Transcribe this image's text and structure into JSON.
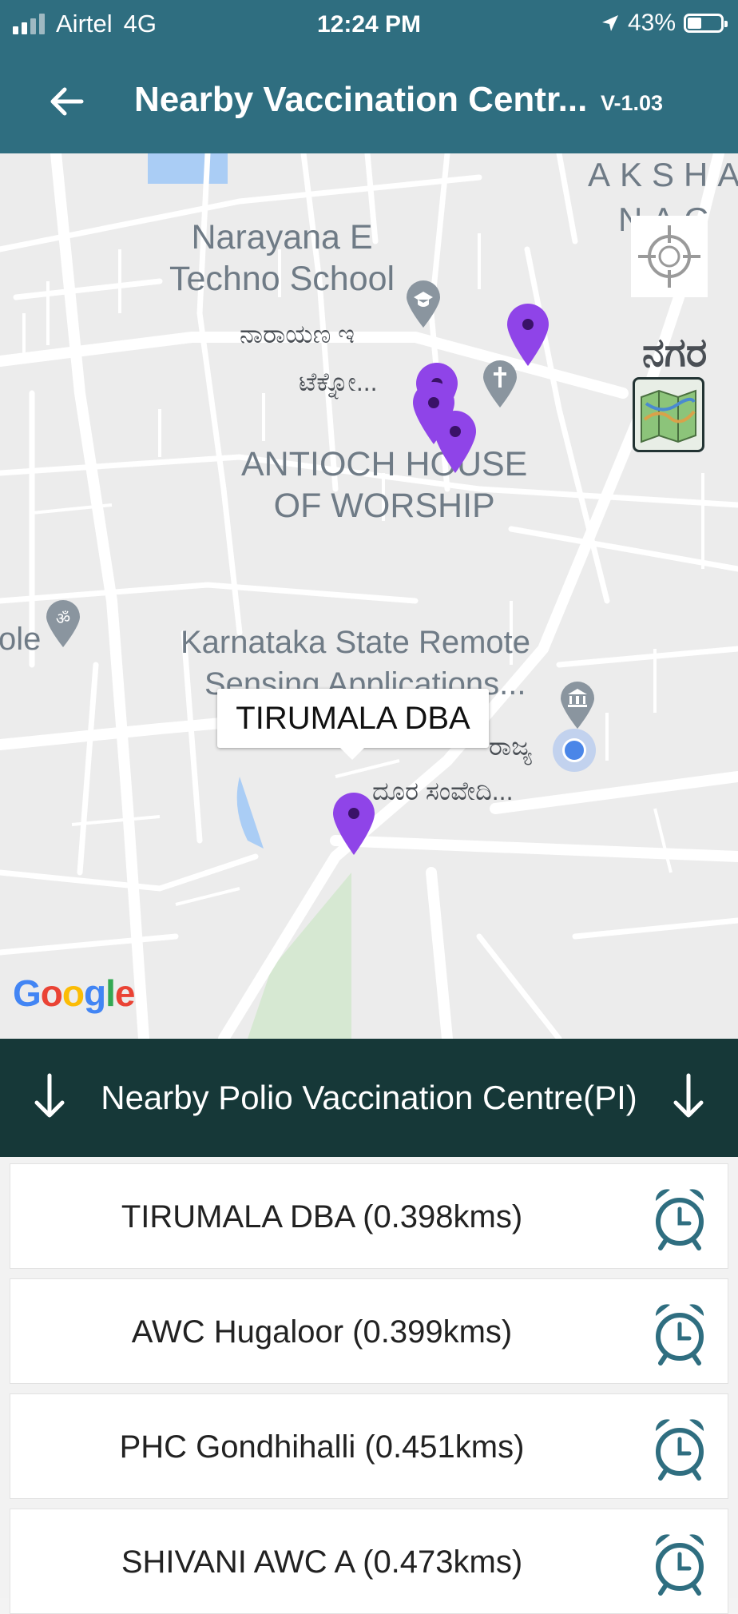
{
  "status_bar": {
    "carrier": "Airtel",
    "network": "4G",
    "time": "12:24 PM",
    "battery": "43%",
    "battery_level": 0.43,
    "signal_bars": 2
  },
  "app_bar": {
    "back_icon": "arrow-left-icon",
    "title": "Nearby Vaccination Centr...",
    "version": "V-1.03"
  },
  "map": {
    "labels": {
      "aksha": "AKSHA",
      "nagar_partial": "NAG",
      "nagara_kannada": "ನಗರ",
      "narayana_school": "Narayana E\nTechno School",
      "narayana_kannada_1": "ನಾರಾಯಣ ಇ",
      "narayana_kannada_2": "ಟೆಕ್ನೋ...",
      "antioch": "ANTIOCH HOUSE\nOF WORSHIP",
      "karnataka_remote_1": "Karnataka State Remote",
      "karnataka_remote_2": "Sensing Applications...",
      "karnataka_kannada_1": "ರಾಜ್ಯ",
      "karnataka_kannada_2": "ದೂರ ಸಂವೇದಿ...",
      "temple_partial": "ole"
    },
    "info_window": "TIRUMALA DBA",
    "attribution": "Google",
    "pin_color": "#8f44e8",
    "my_location_icon": "my-location-icon",
    "layers_icon": "map-layers-icon"
  },
  "section_header": {
    "label": "Nearby Polio Vaccination Centre(PI)",
    "left_icon": "arrow-down-icon",
    "right_icon": "arrow-down-icon"
  },
  "centres": [
    {
      "name": "TIRUMALA DBA (0.398kms)",
      "icon": "alarm-clock-icon"
    },
    {
      "name": "AWC Hugaloor (0.399kms)",
      "icon": "alarm-clock-icon"
    },
    {
      "name": "PHC Gondhihalli (0.451kms)",
      "icon": "alarm-clock-icon"
    },
    {
      "name": "SHIVANI AWC A (0.473kms)",
      "icon": "alarm-clock-icon"
    }
  ],
  "colors": {
    "app_bar": "#2f6e80",
    "section_header": "#163838",
    "icon_blue": "#2f6e80"
  }
}
